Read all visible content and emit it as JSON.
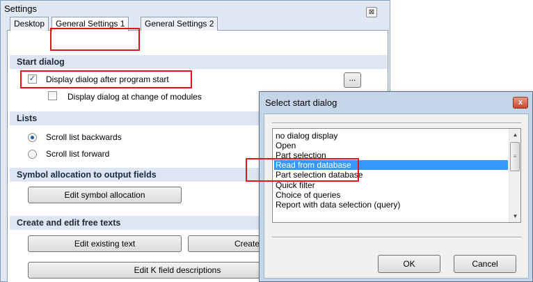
{
  "settings": {
    "title": "Settings",
    "close_glyph": "⊠",
    "tabs": [
      {
        "label": "Desktop"
      },
      {
        "label": "General Settings 1"
      },
      {
        "label": "General Settings 2"
      }
    ],
    "start_dialog": {
      "header": "Start dialog",
      "display_after_start": "Display dialog after program start",
      "display_after_start_checked": true,
      "display_at_change": "Display dialog at change of modules",
      "display_at_change_checked": false,
      "browse_label": "..."
    },
    "lists": {
      "header": "Lists",
      "scroll_backwards": "Scroll list backwards",
      "scroll_forward": "Scroll list forward",
      "selected": "Scroll list backwards"
    },
    "symbol_allocation": {
      "header": "Symbol allocation to output fields",
      "edit_button": "Edit symbol allocation"
    },
    "free_texts": {
      "header": "Create and edit free texts",
      "edit_existing": "Edit existing text",
      "create_partial": "Create",
      "edit_k_field": "Edit K field descriptions"
    },
    "highlight_color": "#e0141a"
  },
  "dialog": {
    "title": "Select start dialog",
    "close_glyph": "x",
    "items": [
      "no dialog display",
      "Open",
      "Part selection",
      "Read from database",
      "Part selection database",
      "Quick filter",
      "Choice of queries",
      "Report with data selection (query)"
    ],
    "selected_item": "Read from database",
    "ok_label": "OK",
    "cancel_label": "Cancel",
    "selection_color": "#3399ff"
  }
}
